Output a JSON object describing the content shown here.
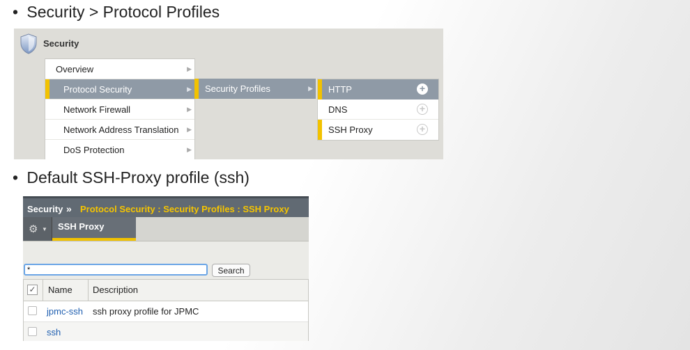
{
  "bullets": {
    "first": "Security > Protocol Profiles",
    "second": "Default SSH-Proxy profile (ssh)"
  },
  "menu": {
    "header": "Security",
    "level1": [
      {
        "label": "Overview"
      },
      {
        "label": "Protocol Security"
      },
      {
        "label": "Network Firewall"
      },
      {
        "label": "Network Address Translation"
      },
      {
        "label": "DoS Protection"
      }
    ],
    "level2": [
      {
        "label": "Security Profiles"
      }
    ],
    "level3": [
      {
        "label": "HTTP"
      },
      {
        "label": "DNS"
      },
      {
        "label": "SSH Proxy"
      }
    ],
    "arrow_glyph": "▶",
    "plus_glyph": "+"
  },
  "panel": {
    "breadcrumb_root": "Security",
    "breadcrumb_sep": "»",
    "breadcrumb_path": "Protocol Security : Security Profiles : SSH Proxy",
    "tab_label": "SSH Proxy",
    "gear_glyph": "⚙",
    "caret_glyph": "▼",
    "search_value": "*",
    "search_button": "Search",
    "columns": {
      "name": "Name",
      "description": "Description"
    },
    "header_check_glyph": "✓",
    "rows": [
      {
        "name": "jpmc-ssh",
        "description": "ssh proxy profile for JPMC"
      },
      {
        "name": "ssh",
        "description": ""
      }
    ]
  },
  "colors": {
    "accent_yellow": "#f2c200",
    "selected_gray": "#8f9aa6",
    "link_blue": "#1f5fb0"
  }
}
